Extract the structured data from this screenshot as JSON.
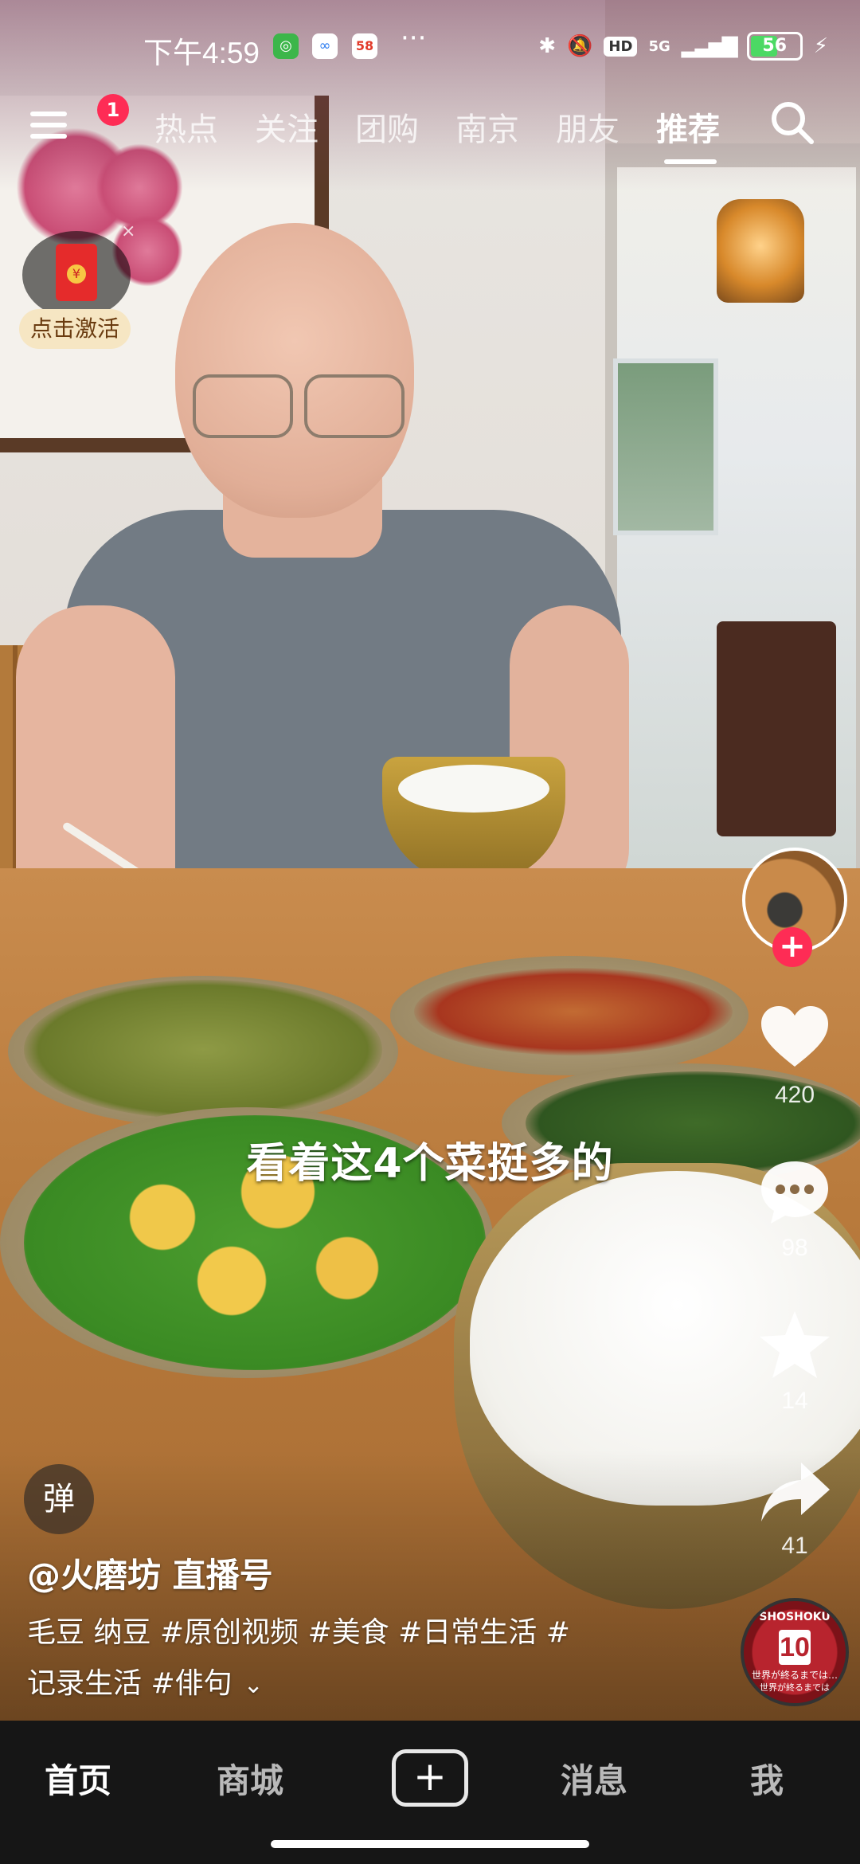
{
  "status_bar": {
    "time": "下午4:59",
    "more": "···",
    "network": "5G",
    "hd": "HD",
    "battery": "56"
  },
  "top_nav": {
    "menu_badge": "1",
    "tabs": [
      {
        "label": "热点"
      },
      {
        "label": "关注"
      },
      {
        "label": "团购"
      },
      {
        "label": "南京"
      },
      {
        "label": "朋友"
      },
      {
        "label": "推荐"
      }
    ],
    "active_tab": "推荐"
  },
  "red_packet": {
    "label": "点击激活",
    "close": "×",
    "seal": "¥"
  },
  "video": {
    "subtitle": "看着这4个菜挺多的",
    "danmu": "弹"
  },
  "right_rail": {
    "like_count": "420",
    "comment_count": "98",
    "favorite_count": "14",
    "share_count": "41",
    "follow_plus": "+",
    "music_disc": {
      "top": "SHOSHOKU",
      "number": "10",
      "middle": "世界が終るまでは…",
      "bottom": "世界が終るまでは"
    }
  },
  "info": {
    "author": "@火磨坊 直播号",
    "description_line1": "毛豆 纳豆 #原创视频  #美食 #日常生活 #",
    "description_line2": "记录生活 #俳句",
    "expand": "⌄"
  },
  "bottom_nav": {
    "items": [
      {
        "label": "首页"
      },
      {
        "label": "商城"
      },
      {
        "label": "消息"
      },
      {
        "label": "我"
      }
    ],
    "plus": "+"
  },
  "colors": {
    "accent_red": "#fe2c55",
    "nav_bg": "#161616"
  }
}
